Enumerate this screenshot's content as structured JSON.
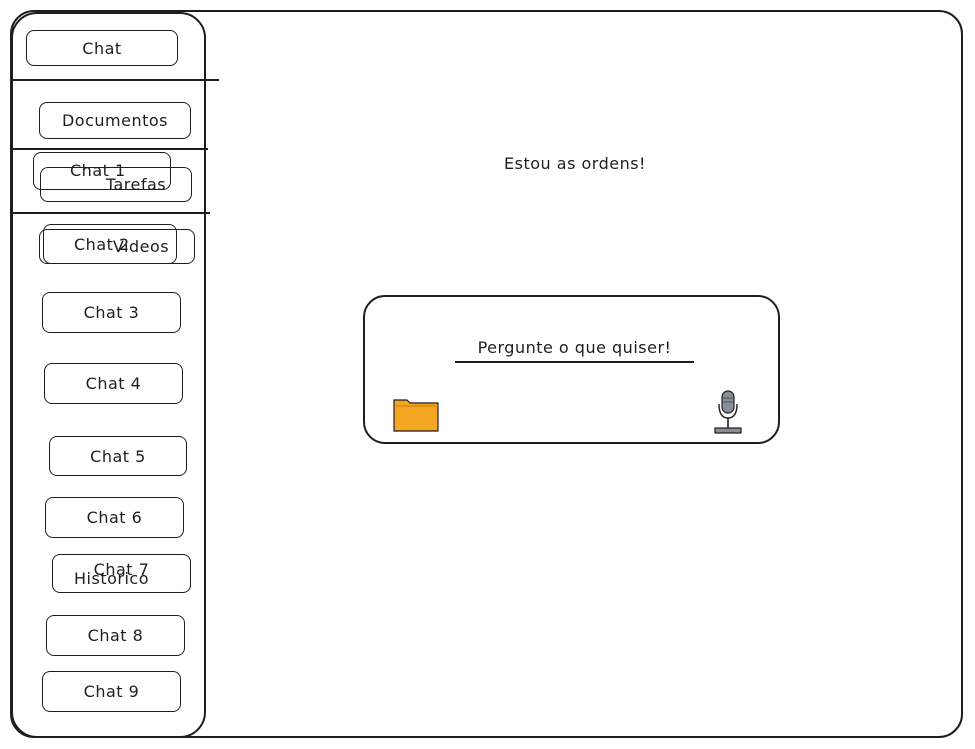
{
  "sidebar": {
    "new_chat": "Chat",
    "menu": {
      "documentos": "Documentos",
      "tarefas": "Tarefas",
      "videos": "Videos",
      "historico": "Historico"
    },
    "chats": [
      "Chat 1",
      "Chat 2",
      "Chat 3",
      "Chat 4",
      "Chat 5",
      "Chat 6",
      "Chat 7",
      "Chat 8",
      "Chat 9"
    ]
  },
  "main": {
    "greeting": "Estou as ordens!",
    "prompt_placeholder": "Pergunte o que quiser!"
  },
  "icons": {
    "attach": "folder-icon",
    "voice": "microphone-icon"
  },
  "colors": {
    "stroke": "#1e1e1e",
    "folder": "#f5a623",
    "mic": "#868e96"
  }
}
